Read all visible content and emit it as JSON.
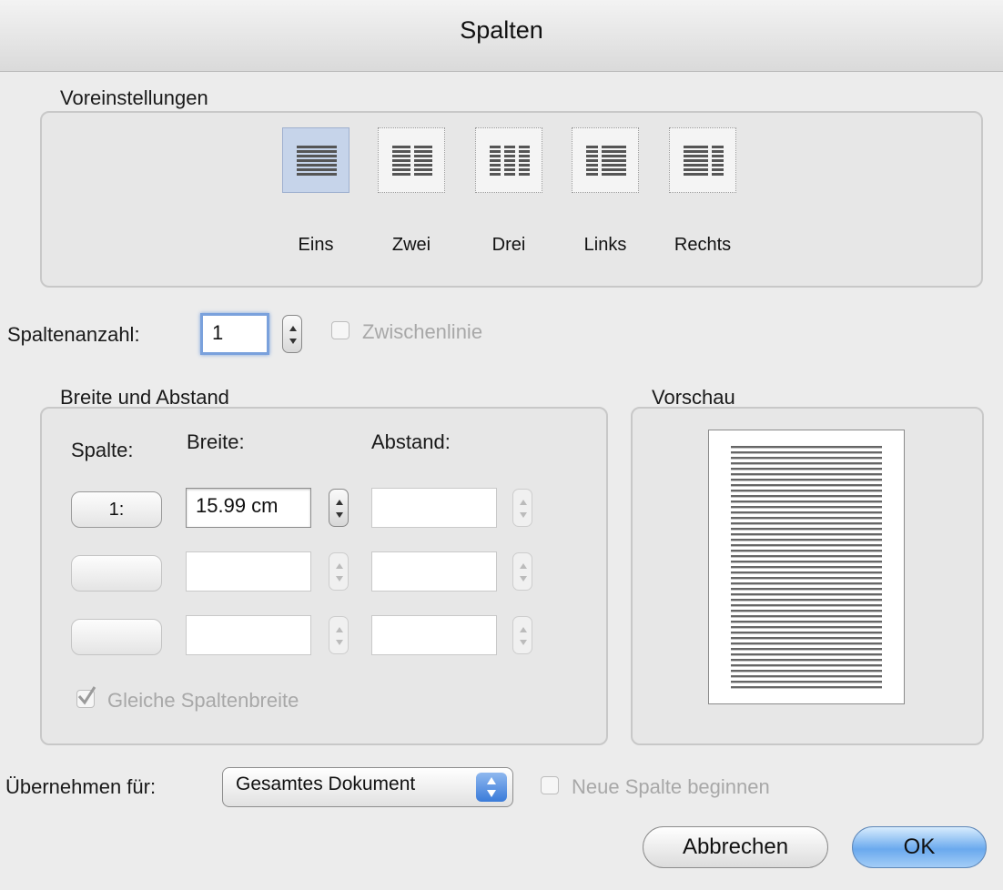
{
  "dialog": {
    "title": "Spalten"
  },
  "presets": {
    "heading": "Voreinstellungen",
    "items": [
      {
        "label": "Eins",
        "icon": "preset-one-column-icon",
        "selected": true
      },
      {
        "label": "Zwei",
        "icon": "preset-two-columns-icon",
        "selected": false
      },
      {
        "label": "Drei",
        "icon": "preset-three-columns-icon",
        "selected": false
      },
      {
        "label": "Links",
        "icon": "preset-left-column-icon",
        "selected": false
      },
      {
        "label": "Rechts",
        "icon": "preset-right-column-icon",
        "selected": false
      }
    ]
  },
  "column_count": {
    "label": "Spaltenanzahl:",
    "value": "1",
    "line_between_label": "Zwischenlinie"
  },
  "width_spacing": {
    "heading": "Breite und Abstand",
    "col_header": "Spalte:",
    "width_header": "Breite:",
    "spacing_header": "Abstand:",
    "rows": [
      {
        "column": "1:",
        "width": "15.99 cm",
        "spacing": ""
      },
      {
        "column": "",
        "width": "",
        "spacing": ""
      },
      {
        "column": "",
        "width": "",
        "spacing": ""
      }
    ],
    "equal_width_label": "Gleiche Spaltenbreite",
    "equal_width_checked": true
  },
  "preview": {
    "heading": "Vorschau"
  },
  "apply": {
    "label": "Übernehmen für:",
    "value": "Gesamtes Dokument",
    "new_column_label": "Neue Spalte beginnen"
  },
  "buttons": {
    "cancel": "Abbrechen",
    "ok": "OK"
  },
  "colors": {
    "accent": "#6aa9ee",
    "selection": "#c6d4ea",
    "disabled_text": "#a8a8a8"
  }
}
